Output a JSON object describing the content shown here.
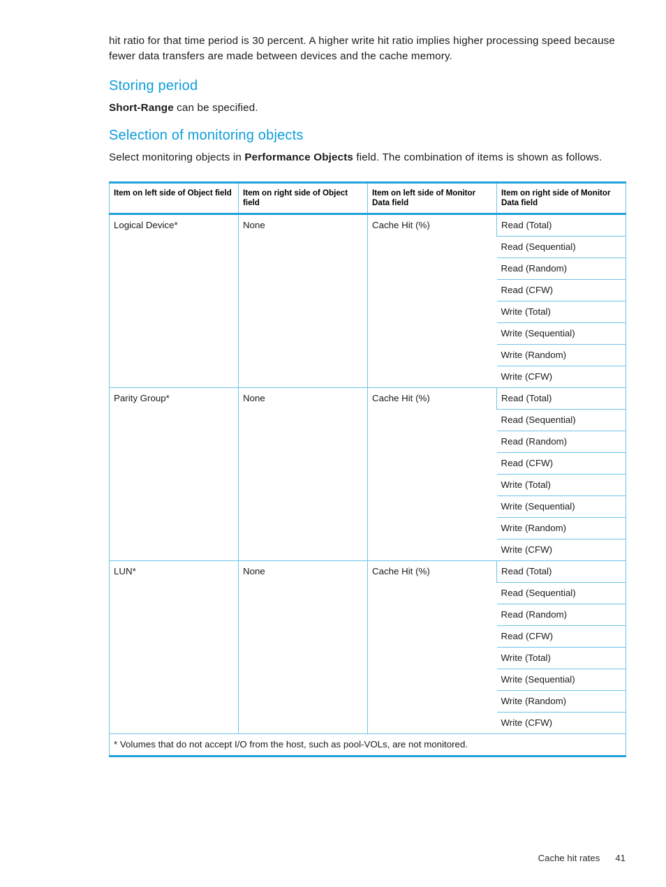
{
  "document": {
    "intro_paragraph": "hit ratio for that time period is 30 percent. A higher write hit ratio implies higher processing speed because fewer data transfers are made between devices and the cache memory.",
    "sections": {
      "storing_period": {
        "heading": "Storing period",
        "body_bold": "Short-Range",
        "body_rest": " can be specified."
      },
      "selection_of_monitoring_objects": {
        "heading": "Selection of monitoring objects",
        "body_lead": "Select monitoring objects in ",
        "body_bold": "Performance Objects",
        "body_rest": " field. The combination of items is shown as follows."
      }
    },
    "table": {
      "headers": [
        "Item on left side of Object field",
        "Item on right side of Object field",
        "Item on left side of Monitor Data field",
        "Item on right side of Monitor Data field"
      ],
      "groups": [
        {
          "object_left": "Logical Device*",
          "object_right": "None",
          "monitor_left": "Cache Hit (%)",
          "monitor_right": [
            "Read (Total)",
            "Read (Sequential)",
            "Read (Random)",
            "Read (CFW)",
            "Write (Total)",
            "Write (Sequential)",
            "Write (Random)",
            "Write (CFW)"
          ]
        },
        {
          "object_left": "Parity Group*",
          "object_right": "None",
          "monitor_left": "Cache Hit (%)",
          "monitor_right": [
            "Read (Total)",
            "Read (Sequential)",
            "Read (Random)",
            "Read (CFW)",
            "Write (Total)",
            "Write (Sequential)",
            "Write (Random)",
            "Write (CFW)"
          ]
        },
        {
          "object_left": "LUN*",
          "object_right": "None",
          "monitor_left": "Cache Hit (%)",
          "monitor_right": [
            "Read (Total)",
            "Read (Sequential)",
            "Read (Random)",
            "Read (CFW)",
            "Write (Total)",
            "Write (Sequential)",
            "Write (Random)",
            "Write (CFW)"
          ]
        }
      ],
      "footnote": "* Volumes that do not accept I/O from the host, such as pool-VOLs, are not monitored."
    },
    "footer": {
      "running_head": "Cache hit rates",
      "page_number": "41"
    },
    "colors": {
      "heading_blue": "#0d9ddb",
      "table_rule_blue": "#1fa3dd",
      "table_inner_blue": "#6ec4e8",
      "text_black": "#1a1a1a"
    }
  }
}
